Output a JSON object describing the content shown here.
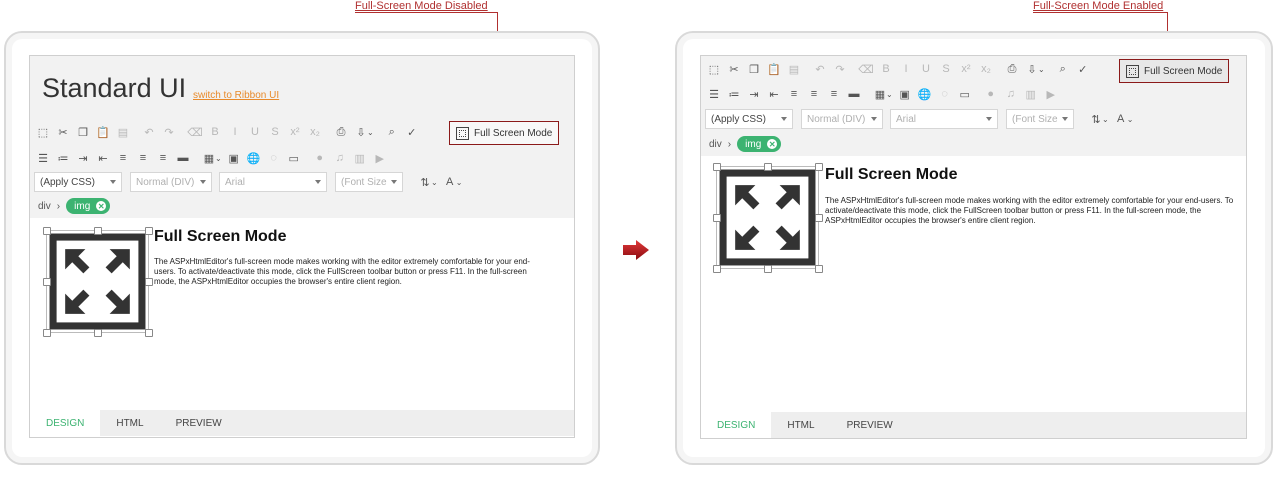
{
  "callouts": {
    "disabled": "Full-Screen Mode Disabled",
    "enabled": "Full-Screen Mode Enabled"
  },
  "left": {
    "title": "Standard UI",
    "switch_link": "switch to Ribbon UI"
  },
  "toolbar": {
    "fullscreen_label": "Full Screen Mode",
    "icons_row1": [
      "select-all-icon",
      "cut-icon",
      "copy-icon",
      "paste-icon",
      "paste-word-icon",
      "undo-icon",
      "redo-icon",
      "remove-format-icon",
      "bold-icon",
      "italic-icon",
      "underline-icon",
      "strikethrough-icon",
      "superscript-icon",
      "subscript-icon",
      "print-icon",
      "export-icon",
      "find-icon",
      "spellcheck-icon"
    ],
    "icons_row2": [
      "numbered-list-icon",
      "bullet-list-icon",
      "indent-icon",
      "outdent-icon",
      "align-left-icon",
      "align-center-icon",
      "align-right-icon",
      "justify-icon",
      "table-icon",
      "insert-image-icon",
      "link-icon",
      "unlink-icon",
      "image-icon",
      "flash-icon",
      "audio-icon",
      "video-icon",
      "youtube-icon"
    ],
    "combos": {
      "css": "(Apply CSS)",
      "paragraph": "Normal (DIV)",
      "font": "Arial",
      "size": "(Font Size"
    }
  },
  "breadcrumb": {
    "path": "div",
    "separator": "›",
    "tag": "img"
  },
  "document": {
    "heading": "Full Screen Mode",
    "paragraph": "The ASPxHtmlEditor's full-screen mode makes working with the editor extremely comfortable for your end-users. To activate/deactivate this mode, click the FullScreen toolbar button or press F11. In the full-screen mode, the ASPxHtmlEditor occupies the browser's entire client region."
  },
  "tabs": [
    "DESIGN",
    "HTML",
    "PREVIEW"
  ],
  "colors": {
    "accent": "#3cb371",
    "callout": "#b03030",
    "link": "#e88a2a",
    "arrow": "#c0141c"
  }
}
